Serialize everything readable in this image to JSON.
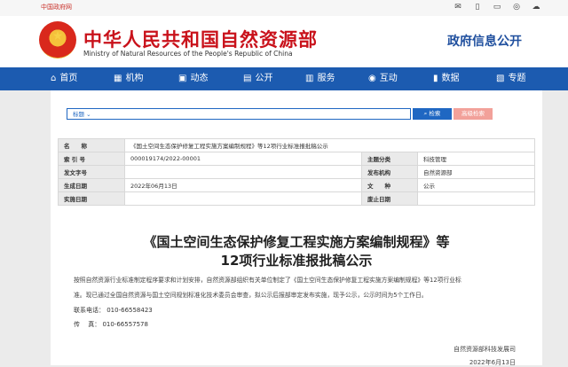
{
  "topbar": {
    "link": "中国政府网",
    "icons": [
      "mail-icon",
      "mobile-icon",
      "device-icon",
      "weibo-icon",
      "wechat-icon"
    ]
  },
  "header": {
    "title_cn": "中华人民共和国自然资源部",
    "title_en": "Ministry of Natural Resources of the People's Republic of China",
    "section": "政府信息公开"
  },
  "nav": [
    {
      "label": "首页",
      "icon": "⌂"
    },
    {
      "label": "机构",
      "icon": "▦"
    },
    {
      "label": "动态",
      "icon": "▣"
    },
    {
      "label": "公开",
      "icon": "▤"
    },
    {
      "label": "服务",
      "icon": "▥"
    },
    {
      "label": "互动",
      "icon": "◉"
    },
    {
      "label": "数据",
      "icon": "▮"
    },
    {
      "label": "专题",
      "icon": "▧"
    }
  ],
  "search": {
    "field_label": "标题",
    "button": "检索",
    "advanced": "高级检索"
  },
  "meta": {
    "name_k": "名　　称",
    "name_v": "《国土空间生态保护修复工程实施方案编制规程》等12项行业标准报批稿公示",
    "index_k": "索 引 号",
    "index_v": "000019174/2022-00001",
    "cat_k": "主题分类",
    "cat_v": "科技管理",
    "doc_k": "发文字号",
    "doc_v": "",
    "org_k": "发布机构",
    "org_v": "自然资源部",
    "date_k": "生成日期",
    "date_v": "2022年06月13日",
    "type_k": "文　　种",
    "type_v": "公示",
    "impl_k": "实施日期",
    "impl_v": "",
    "exp_k": "废止日期",
    "exp_v": ""
  },
  "doc": {
    "title_line1": "《国土空间生态保护修复工程实施方案编制规程》等",
    "title_line2": "12项行业标准报批稿公示",
    "paragraph1": "按照自然资源行业标准制定程序要求和计划安排，自然资源部组织有关单位制定了《国土空间生态保护修复工程实施方案编制规程》等12项行业标",
    "paragraph2": "准。现已通过全国自然资源与国土空间规划标准化技术委员会审查，拟公示后报部审定发布实施，现予公示，公示时间为5个工作日。",
    "contact_phone": "联系电话：  010-66558423",
    "contact_fax": "传　  真：  010-66557578",
    "signer": "自然资源部科技发展司",
    "sign_date": "2022年6月13日"
  }
}
